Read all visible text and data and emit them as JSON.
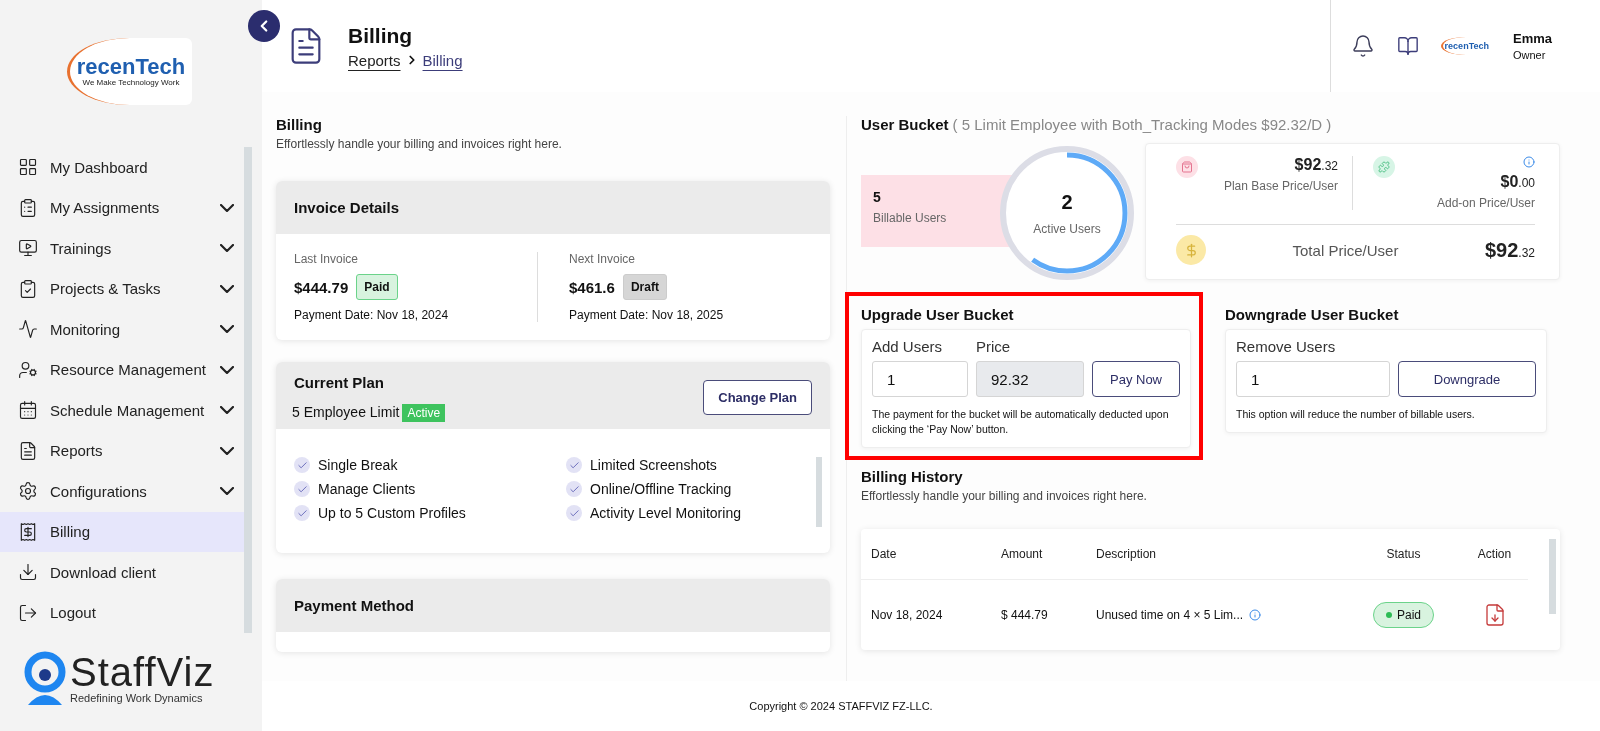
{
  "sidebar": {
    "logo": {
      "name": "recenTech",
      "tagline": "We Make Technology Work"
    },
    "items": [
      {
        "label": "My Dashboard",
        "has_submenu": false,
        "selected": false
      },
      {
        "label": "My Assignments",
        "has_submenu": true,
        "selected": false
      },
      {
        "label": "Trainings",
        "has_submenu": true,
        "selected": false
      },
      {
        "label": "Projects & Tasks",
        "has_submenu": true,
        "selected": false
      },
      {
        "label": "Monitoring",
        "has_submenu": true,
        "selected": false
      },
      {
        "label": "Resource Management",
        "has_submenu": true,
        "selected": false
      },
      {
        "label": "Schedule Management",
        "has_submenu": true,
        "selected": false
      },
      {
        "label": "Reports",
        "has_submenu": true,
        "selected": false
      },
      {
        "label": "Configurations",
        "has_submenu": true,
        "selected": false
      },
      {
        "label": "Billing",
        "has_submenu": false,
        "selected": true
      },
      {
        "label": "Download client",
        "has_submenu": false,
        "selected": false
      },
      {
        "label": "Logout",
        "has_submenu": false,
        "selected": false
      }
    ],
    "brand": {
      "name": "StaffViz",
      "tagline": "Redefining Work Dynamics"
    }
  },
  "header": {
    "title": "Billing",
    "breadcrumb": [
      "Reports",
      "Billing"
    ],
    "user": {
      "logo": "recenTech",
      "name": "Emma",
      "role": "Owner"
    }
  },
  "page": {
    "title": "Billing",
    "subtitle": "Effortlessly handle your billing and invoices right here."
  },
  "invoice_details": {
    "title": "Invoice Details",
    "invoices": [
      {
        "label": "Last Invoice",
        "amount": "$444.79",
        "status": "Paid",
        "kind": "paid",
        "date": "Payment Date: Nov 18, 2024"
      },
      {
        "label": "Next Invoice",
        "amount": "$461.6",
        "status": "Draft",
        "kind": "draft",
        "date": "Payment Date: Nov 18, 2025"
      }
    ]
  },
  "current_plan": {
    "title": "Current Plan",
    "plan": "5 Employee Limit",
    "badge": "Active",
    "button": "Change Plan",
    "features": [
      "Single Break",
      "Limited Screenshots",
      "Manage Clients",
      "Online/Offline Tracking",
      "Up to 5 Custom Profiles",
      "Activity Level Monitoring"
    ]
  },
  "payment_method": {
    "title": "Payment Method"
  },
  "user_bucket": {
    "title": "User Bucket",
    "detail": "( 5 Limit Employee with Both_Tracking Modes $92.32/D )",
    "billable": {
      "value": "5",
      "label": "Billable Users"
    },
    "active": {
      "value": "2",
      "label": "Active Users",
      "level": 0.6
    },
    "prices": [
      {
        "whole": "$92",
        "cents": ".32",
        "label": "Plan Base Price/User"
      },
      {
        "whole": "$0",
        "cents": ".00",
        "label": "Add-on Price/User"
      }
    ],
    "total": {
      "label": "Total Price/User",
      "whole": "$92",
      "cents": ".32"
    }
  },
  "upgrade": {
    "title": "Upgrade User Bucket",
    "highlighted": true,
    "add_label": "Add Users",
    "add_value": "1",
    "price_label": "Price",
    "price_value": "92.32",
    "button": "Pay Now",
    "note": "The payment for the bucket will be automatically deducted upon clicking the ‘Pay Now’ button."
  },
  "downgrade": {
    "title": "Downgrade User Bucket",
    "remove_label": "Remove Users",
    "remove_value": "1",
    "button": "Downgrade",
    "note": "This option will reduce the number of billable users."
  },
  "billing_history": {
    "title": "Billing History",
    "subtitle": "Effortlessly handle your billing and invoices right here.",
    "columns": [
      "Date",
      "Amount",
      "Description",
      "Status",
      "Action"
    ],
    "rows": [
      {
        "date": "Nov 18, 2024",
        "amount": "$ 444.79",
        "description": "Unused time on 4 × 5 Lim...",
        "status": "Paid",
        "kind": "paid"
      }
    ]
  },
  "footer": "Copyright © 2024 STAFFVIZ FZ-LLC."
}
